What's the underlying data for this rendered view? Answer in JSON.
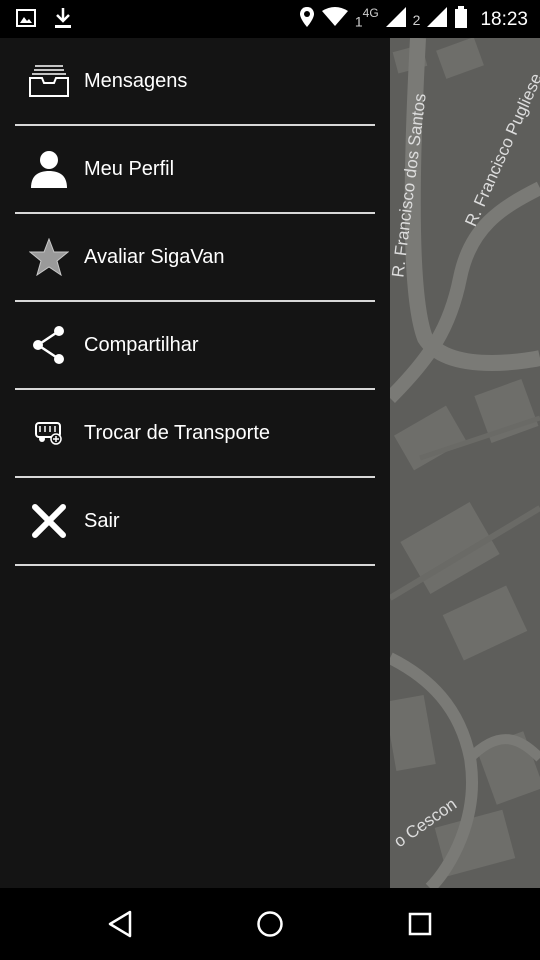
{
  "status_bar": {
    "sim1_label": "1",
    "network_type": "4G",
    "sim2_label": "2",
    "time": "18:23",
    "icons": [
      "image-icon",
      "download-icon",
      "location-pin-icon",
      "wifi-icon",
      "signal-icon",
      "signal-icon",
      "battery-icon"
    ]
  },
  "drawer": {
    "items": [
      {
        "label": "Mensagens",
        "icon": "inbox-icon"
      },
      {
        "label": "Meu Perfil",
        "icon": "person-icon"
      },
      {
        "label": "Avaliar SigaVan",
        "icon": "star-icon"
      },
      {
        "label": "Compartilhar",
        "icon": "share-icon"
      },
      {
        "label": "Trocar de Transporte",
        "icon": "bus-icon"
      },
      {
        "label": "Sair",
        "icon": "close-icon"
      }
    ]
  },
  "map": {
    "streets": [
      "R. Francisco dos Santos",
      "R. Francisco Pugliese",
      "o Cescon"
    ]
  },
  "nav_bar": {
    "buttons": [
      "back-icon",
      "home-icon",
      "recents-icon"
    ]
  }
}
